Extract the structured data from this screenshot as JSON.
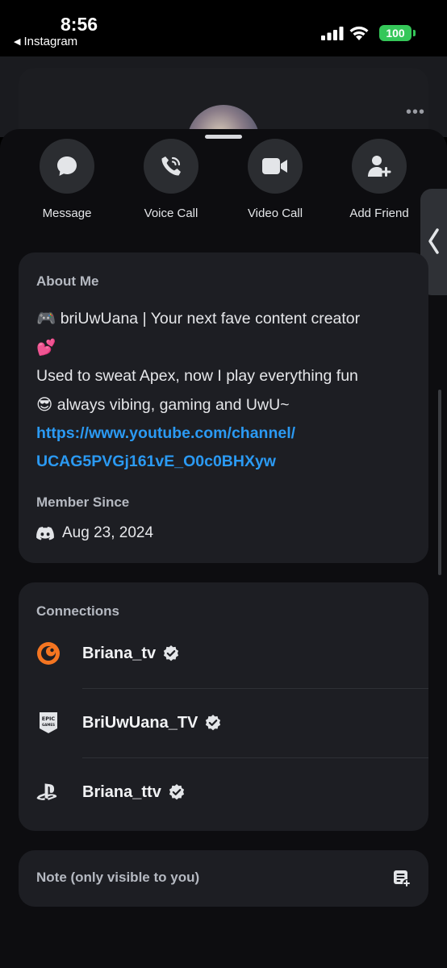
{
  "status_bar": {
    "time": "8:56",
    "back_app": "Instagram",
    "battery": "100"
  },
  "actions": [
    {
      "label": "Message",
      "icon": "message-bubble-icon"
    },
    {
      "label": "Voice Call",
      "icon": "phone-call-icon"
    },
    {
      "label": "Video Call",
      "icon": "video-camera-icon"
    },
    {
      "label": "Add Friend",
      "icon": "add-friend-icon"
    }
  ],
  "about": {
    "title": "About Me",
    "line1": "briUwUana | Your next fave content creator",
    "line3": "Used to sweat Apex, now I play everything fun",
    "line4": "always vibing, gaming and UwU~",
    "link_line1": "https://www.youtube.com/channel/",
    "link_line2": "UCAG5PVGj161vE_O0c0BHXyw",
    "emoji_gamepad": "🎮",
    "emoji_hearts": "💕",
    "emoji_sunglasses": "😎"
  },
  "member_since": {
    "title": "Member Since",
    "date": "Aug 23, 2024"
  },
  "connections": {
    "title": "Connections",
    "items": [
      {
        "name": "Briana_tv",
        "service": "crunchyroll-icon",
        "verified": true
      },
      {
        "name": "BriUwUana_TV",
        "service": "epic-games-icon",
        "verified": true
      },
      {
        "name": "Briana_ttv",
        "service": "playstation-icon",
        "verified": true
      }
    ]
  },
  "note": {
    "placeholder": "Note (only visible to you)"
  },
  "colors": {
    "accent_link": "#2b9af3",
    "battery": "#35c759",
    "card_bg": "#1d1e23",
    "sheet_bg": "#0d0d10"
  }
}
